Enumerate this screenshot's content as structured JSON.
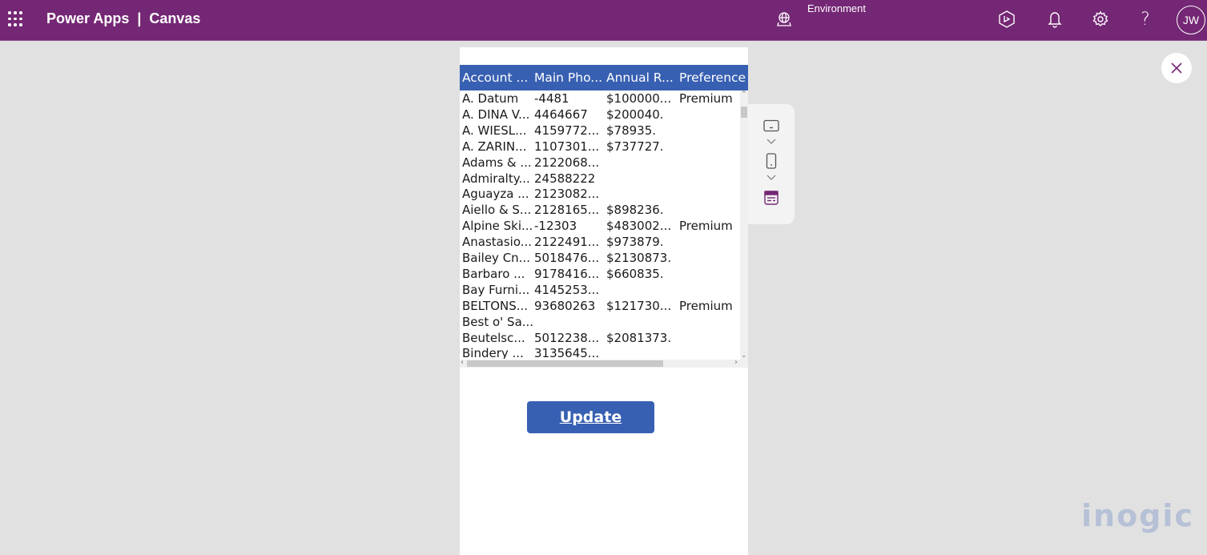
{
  "topbar": {
    "app_name": "Power Apps",
    "separator": "|",
    "section": "Canvas",
    "environment_label": "Environment",
    "environment_value": "",
    "avatar_initials": "JW",
    "icons": [
      "waffle-icon",
      "environment-icon",
      "copilot-icon",
      "notification-bell-icon",
      "settings-gear-icon",
      "help-question-icon"
    ]
  },
  "grid": {
    "columns": [
      "Account ...",
      "Main Pho...",
      "Annual R...",
      "Preference"
    ],
    "rows": [
      [
        "A. Datum",
        "-4481",
        "$100000...",
        "Premium"
      ],
      [
        "A. DINA V...",
        "4464667",
        "$200040.",
        ""
      ],
      [
        "A. WIESL...",
        "4159772...",
        "$78935.",
        ""
      ],
      [
        "A. ZARIN...",
        "1107301...",
        "$737727.",
        ""
      ],
      [
        "Adams & ...",
        "2122068...",
        "",
        ""
      ],
      [
        "Admiralty...",
        "24588222",
        "",
        ""
      ],
      [
        "Aguayza ...",
        "2123082...",
        "",
        ""
      ],
      [
        "Aiello & S...",
        "2128165...",
        "$898236.",
        ""
      ],
      [
        "Alpine Ski...",
        "-12303",
        "$483002...",
        "Premium"
      ],
      [
        "Anastasio...",
        "2122491...",
        "$973879.",
        ""
      ],
      [
        "Bailey Cn...",
        "5018476...",
        "$2130873.",
        ""
      ],
      [
        "Barbaro ...",
        "9178416...",
        "$660835.",
        ""
      ],
      [
        "Bay Furni...",
        "4145253...",
        "",
        ""
      ],
      [
        "BELTONS...",
        "93680263",
        "$121730...",
        "Premium"
      ],
      [
        "Best o' Sa...",
        "",
        "",
        ""
      ],
      [
        "Beutelsc...",
        "5012238...",
        "$2081373.",
        ""
      ],
      [
        "Bindery ...",
        "3135645...",
        "",
        ""
      ]
    ]
  },
  "update_button": {
    "label": "Update"
  },
  "device_panel": {
    "items": [
      "tablet-layout-icon",
      "chevron-down-icon",
      "phone-layout-icon",
      "chevron-down-icon",
      "form-view-icon"
    ]
  },
  "close_button": {
    "label": "Close"
  },
  "watermark": {
    "text": "inogic"
  },
  "colors": {
    "brand": "#742774",
    "grid_header": "#3860b2",
    "button": "#3860b2",
    "canvas_bg": "#e1e1e1",
    "watermark": "#b6c0d6"
  }
}
